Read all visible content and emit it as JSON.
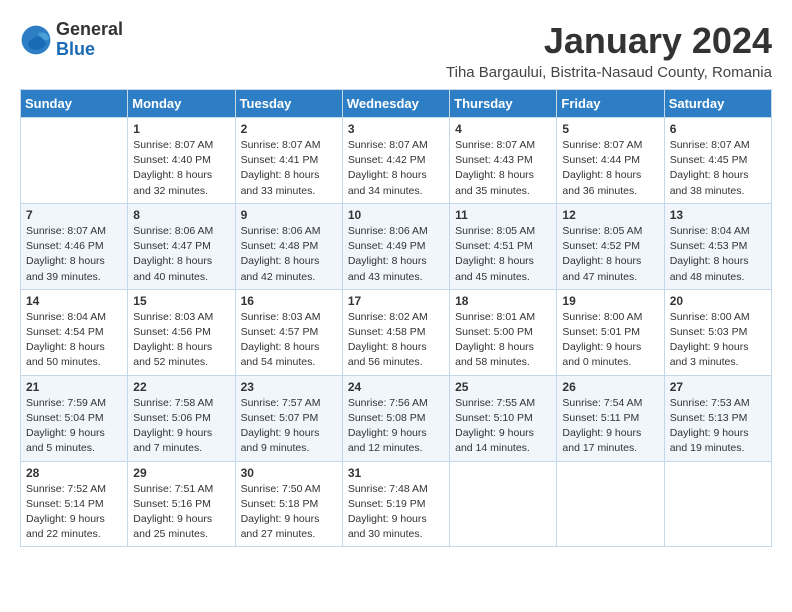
{
  "logo": {
    "general": "General",
    "blue": "Blue"
  },
  "title": "January 2024",
  "subtitle": "Tiha Bargaului, Bistrita-Nasaud County, Romania",
  "days_of_week": [
    "Sunday",
    "Monday",
    "Tuesday",
    "Wednesday",
    "Thursday",
    "Friday",
    "Saturday"
  ],
  "weeks": [
    [
      {
        "day": "",
        "info": ""
      },
      {
        "day": "1",
        "info": "Sunrise: 8:07 AM\nSunset: 4:40 PM\nDaylight: 8 hours\nand 32 minutes."
      },
      {
        "day": "2",
        "info": "Sunrise: 8:07 AM\nSunset: 4:41 PM\nDaylight: 8 hours\nand 33 minutes."
      },
      {
        "day": "3",
        "info": "Sunrise: 8:07 AM\nSunset: 4:42 PM\nDaylight: 8 hours\nand 34 minutes."
      },
      {
        "day": "4",
        "info": "Sunrise: 8:07 AM\nSunset: 4:43 PM\nDaylight: 8 hours\nand 35 minutes."
      },
      {
        "day": "5",
        "info": "Sunrise: 8:07 AM\nSunset: 4:44 PM\nDaylight: 8 hours\nand 36 minutes."
      },
      {
        "day": "6",
        "info": "Sunrise: 8:07 AM\nSunset: 4:45 PM\nDaylight: 8 hours\nand 38 minutes."
      }
    ],
    [
      {
        "day": "7",
        "info": "Sunrise: 8:07 AM\nSunset: 4:46 PM\nDaylight: 8 hours\nand 39 minutes."
      },
      {
        "day": "8",
        "info": "Sunrise: 8:06 AM\nSunset: 4:47 PM\nDaylight: 8 hours\nand 40 minutes."
      },
      {
        "day": "9",
        "info": "Sunrise: 8:06 AM\nSunset: 4:48 PM\nDaylight: 8 hours\nand 42 minutes."
      },
      {
        "day": "10",
        "info": "Sunrise: 8:06 AM\nSunset: 4:49 PM\nDaylight: 8 hours\nand 43 minutes."
      },
      {
        "day": "11",
        "info": "Sunrise: 8:05 AM\nSunset: 4:51 PM\nDaylight: 8 hours\nand 45 minutes."
      },
      {
        "day": "12",
        "info": "Sunrise: 8:05 AM\nSunset: 4:52 PM\nDaylight: 8 hours\nand 47 minutes."
      },
      {
        "day": "13",
        "info": "Sunrise: 8:04 AM\nSunset: 4:53 PM\nDaylight: 8 hours\nand 48 minutes."
      }
    ],
    [
      {
        "day": "14",
        "info": "Sunrise: 8:04 AM\nSunset: 4:54 PM\nDaylight: 8 hours\nand 50 minutes."
      },
      {
        "day": "15",
        "info": "Sunrise: 8:03 AM\nSunset: 4:56 PM\nDaylight: 8 hours\nand 52 minutes."
      },
      {
        "day": "16",
        "info": "Sunrise: 8:03 AM\nSunset: 4:57 PM\nDaylight: 8 hours\nand 54 minutes."
      },
      {
        "day": "17",
        "info": "Sunrise: 8:02 AM\nSunset: 4:58 PM\nDaylight: 8 hours\nand 56 minutes."
      },
      {
        "day": "18",
        "info": "Sunrise: 8:01 AM\nSunset: 5:00 PM\nDaylight: 8 hours\nand 58 minutes."
      },
      {
        "day": "19",
        "info": "Sunrise: 8:00 AM\nSunset: 5:01 PM\nDaylight: 9 hours\nand 0 minutes."
      },
      {
        "day": "20",
        "info": "Sunrise: 8:00 AM\nSunset: 5:03 PM\nDaylight: 9 hours\nand 3 minutes."
      }
    ],
    [
      {
        "day": "21",
        "info": "Sunrise: 7:59 AM\nSunset: 5:04 PM\nDaylight: 9 hours\nand 5 minutes."
      },
      {
        "day": "22",
        "info": "Sunrise: 7:58 AM\nSunset: 5:06 PM\nDaylight: 9 hours\nand 7 minutes."
      },
      {
        "day": "23",
        "info": "Sunrise: 7:57 AM\nSunset: 5:07 PM\nDaylight: 9 hours\nand 9 minutes."
      },
      {
        "day": "24",
        "info": "Sunrise: 7:56 AM\nSunset: 5:08 PM\nDaylight: 9 hours\nand 12 minutes."
      },
      {
        "day": "25",
        "info": "Sunrise: 7:55 AM\nSunset: 5:10 PM\nDaylight: 9 hours\nand 14 minutes."
      },
      {
        "day": "26",
        "info": "Sunrise: 7:54 AM\nSunset: 5:11 PM\nDaylight: 9 hours\nand 17 minutes."
      },
      {
        "day": "27",
        "info": "Sunrise: 7:53 AM\nSunset: 5:13 PM\nDaylight: 9 hours\nand 19 minutes."
      }
    ],
    [
      {
        "day": "28",
        "info": "Sunrise: 7:52 AM\nSunset: 5:14 PM\nDaylight: 9 hours\nand 22 minutes."
      },
      {
        "day": "29",
        "info": "Sunrise: 7:51 AM\nSunset: 5:16 PM\nDaylight: 9 hours\nand 25 minutes."
      },
      {
        "day": "30",
        "info": "Sunrise: 7:50 AM\nSunset: 5:18 PM\nDaylight: 9 hours\nand 27 minutes."
      },
      {
        "day": "31",
        "info": "Sunrise: 7:48 AM\nSunset: 5:19 PM\nDaylight: 9 hours\nand 30 minutes."
      },
      {
        "day": "",
        "info": ""
      },
      {
        "day": "",
        "info": ""
      },
      {
        "day": "",
        "info": ""
      }
    ]
  ]
}
